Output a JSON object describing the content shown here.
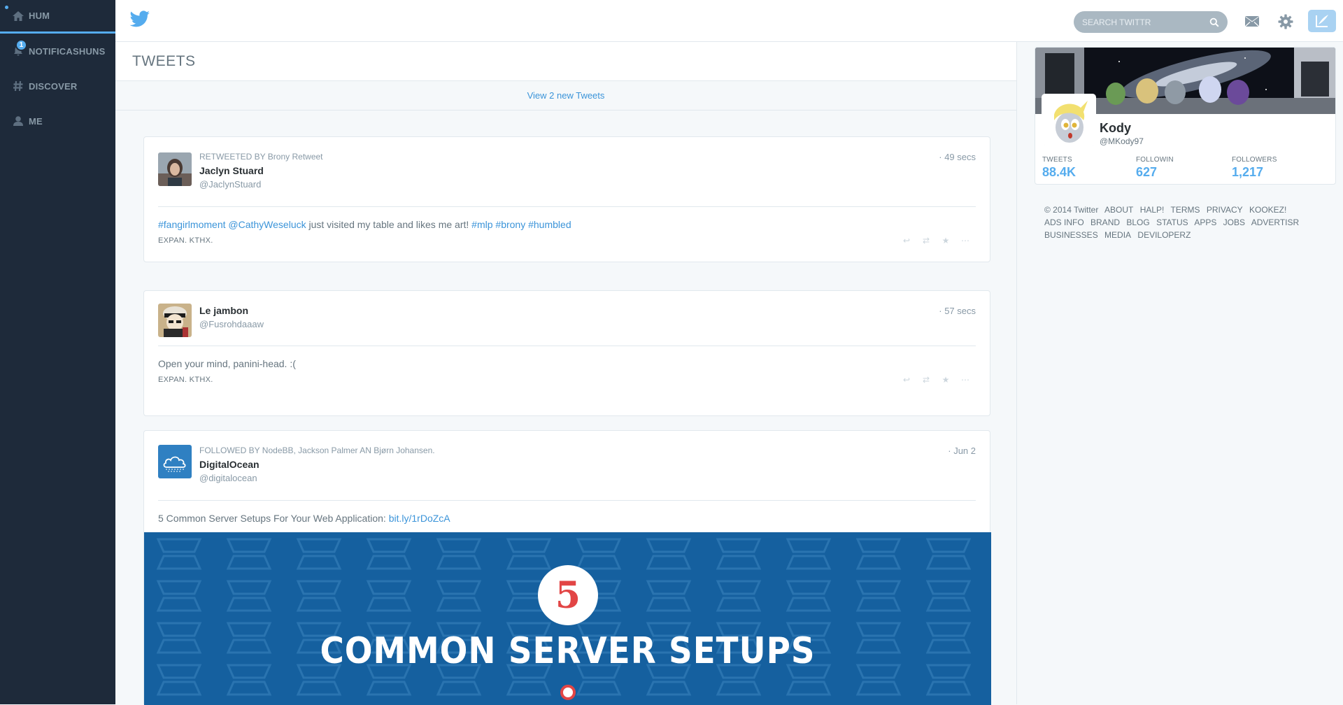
{
  "sidebar": {
    "items": [
      {
        "label": "HUM",
        "icon": "home-icon"
      },
      {
        "label": "NOTIFICASHUNS",
        "icon": "bell-icon",
        "badge": "1"
      },
      {
        "label": "DISCOVER",
        "icon": "hash-icon"
      },
      {
        "label": "ME",
        "icon": "person-icon"
      }
    ]
  },
  "topbar": {
    "search_placeholder": "SEARCH TWITTR"
  },
  "main": {
    "title": "TWEETS",
    "new_tweets": "View 2 new Tweets"
  },
  "tweets": [
    {
      "context": "RETWEETED BY Brony Retweet",
      "name": "Jaclyn Stuard",
      "handle": "@JaclynStuard",
      "time": "· 49 secs",
      "body_parts": [
        "#fangirlmoment",
        " ",
        "@CathyWeseluck",
        " just visited my table and likes me art! ",
        "#mlp",
        " ",
        "#brony",
        " ",
        "#humbled"
      ],
      "expand": "EXPAN. KTHX."
    },
    {
      "name": "Le jambon",
      "handle": "@Fusrohdaaaw",
      "time": "· 57 secs",
      "body": "Open your mind, panini-head. :(",
      "expand": "EXPAN. KTHX."
    },
    {
      "context": "FOLLOWED BY NodeBB, Jackson Palmer AN Bjørn Johansen.",
      "name": "DigitalOcean",
      "handle": "@digitalocean",
      "time": "· Jun 2",
      "body": "5 Common Server Setups For Your Web Application: ",
      "link": "bit.ly/1rDoZcA",
      "promo_number": "5",
      "promo_title": "COMMON SERVER SETUPS"
    }
  ],
  "profile": {
    "name": "Kody",
    "handle": "@MKody97",
    "stats": [
      {
        "label": "TWEETS",
        "value": "88.4K"
      },
      {
        "label": "FOLLOWIN",
        "value": "627"
      },
      {
        "label": "FOLLOWERS",
        "value": "1,217"
      }
    ]
  },
  "footer": {
    "links": [
      "© 2014 Twitter",
      "ABOUT",
      "HALP!",
      "TERMS",
      "PRIVACY",
      "KOOKEZ!",
      "ADS INFO",
      "BRAND",
      "BLOG",
      "STATUS",
      "APPS",
      "JOBS",
      "ADVERTISR",
      "BUSINESSES",
      "MEDIA",
      "DEVILOPERZ"
    ]
  },
  "colors": {
    "accent": "#55acee",
    "link": "#3b94d9",
    "sidebar_bg": "#1e2a3a",
    "promo_bg": "#1662a0"
  }
}
